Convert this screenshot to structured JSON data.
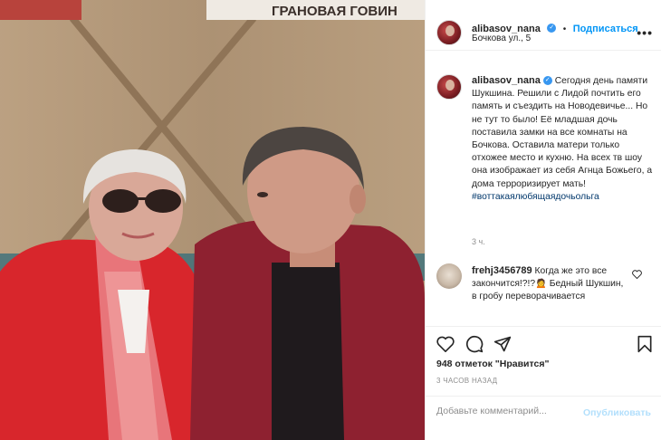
{
  "photo": {
    "sign_text": "ГРАНОВАЯ   ГОВИН"
  },
  "header": {
    "username": "alibasov_nana",
    "verified_icon": "verified-badge-icon",
    "dot": "•",
    "follow_label": "Подписаться",
    "location": "Бочкова ул., 5",
    "more_label": "•••"
  },
  "caption": {
    "username": "alibasov_nana",
    "text": "Сегодня день памяти Шукшина. Решили с Лидой почтить его память и съездить на Новодевичье... Но не тут то было! Её младшая дочь поставила замки на все комнаты на Бочкова. Оставила матери только отхожее место и кухню. На всех тв шоу она изображает из себя Агнца Божьего, а дома терроризирует мать!",
    "hashtag": "#воттакаялюбящаядочьольга",
    "time": "3 ч."
  },
  "comment": {
    "username": "frehj3456789",
    "text": "Когда же это все закончится!?!?🙍 Бедный Шукшин, в гробу переворачивается"
  },
  "actions": {
    "like_icon": "heart-icon",
    "comment_icon": "comment-icon",
    "share_icon": "paper-plane-icon",
    "save_icon": "bookmark-icon"
  },
  "likes": "948 отметок \"Нравится\"",
  "posted_ago": "3 ЧАСОВ НАЗАД",
  "add_comment": {
    "placeholder": "Добавьте комментарий...",
    "publish_label": "Опубликовать"
  },
  "colors": {
    "accent": "#0095f6",
    "verified": "#3897f0",
    "muted": "#8e8e8e",
    "hashtag": "#00376b"
  }
}
